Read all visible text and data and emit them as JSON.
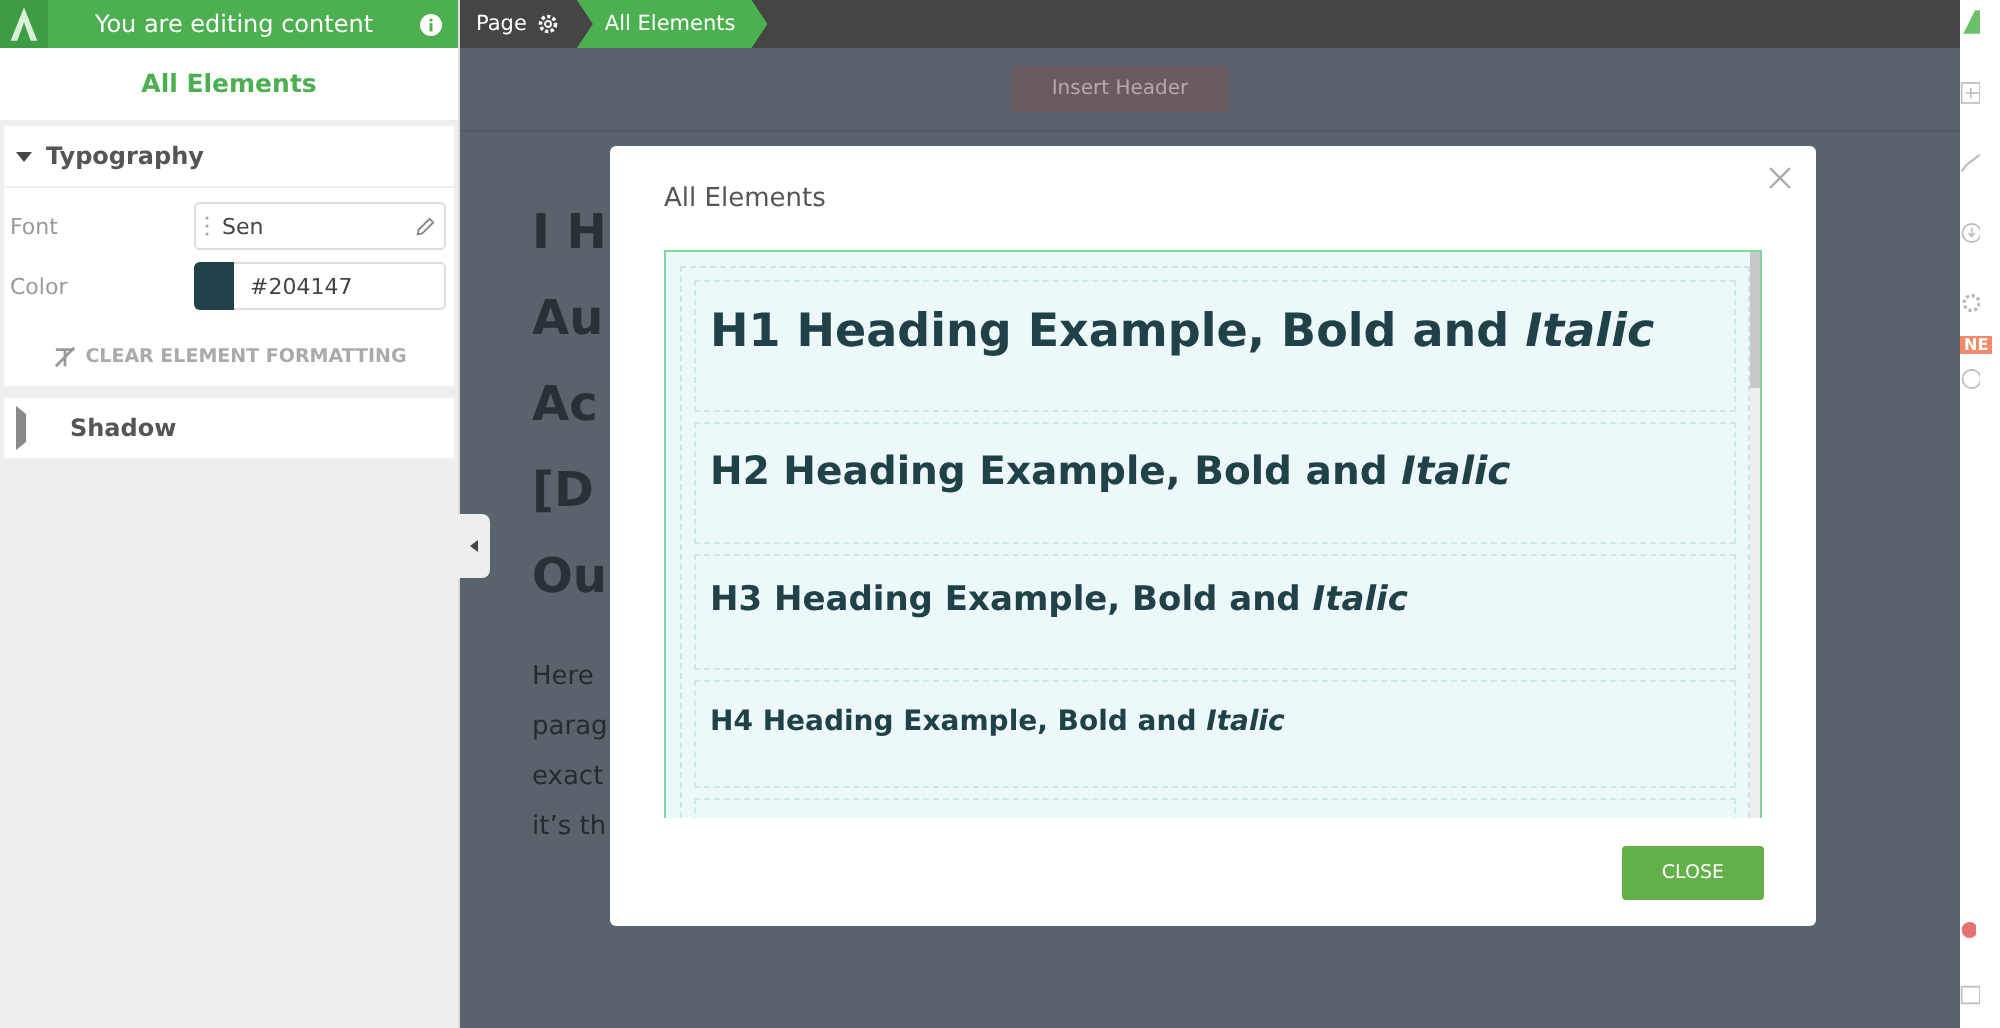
{
  "editor_bar": {
    "title": "You are editing content"
  },
  "panel": {
    "title": "All Elements",
    "sections": [
      {
        "title": "Typography",
        "expanded": true
      },
      {
        "title": "Shadow",
        "expanded": false
      }
    ],
    "font": {
      "label": "Font",
      "value": "Sen"
    },
    "color": {
      "label": "Color",
      "value": "#204147"
    },
    "clear_button": "CLEAR ELEMENT FORMATTING"
  },
  "breadcrumbs": [
    {
      "label": "Page",
      "kind": "page",
      "selected": false
    },
    {
      "label": "All Elements",
      "kind": "element",
      "selected": true
    }
  ],
  "canvas": {
    "insert_button": "Insert Header",
    "heading_lines": [
      "I H",
      "Au",
      "Ac",
      "[D",
      "Ou"
    ],
    "paragraph_lines": [
      "Here",
      "parag",
      "exact",
      "it’s th"
    ]
  },
  "right_toolbar": {
    "badge": "NE"
  },
  "modal": {
    "title": "All Elements",
    "headings": [
      {
        "text": "H1 Heading Example, Bold and *Italic*",
        "kind": "h1"
      },
      {
        "text": "H2 Heading Example, Bold and *Italic*",
        "kind": "h2"
      },
      {
        "text": "H3 Heading Example, Bold and *Italic*",
        "kind": "h3"
      },
      {
        "text": "H4 Heading Example, Bold and *Italic*",
        "kind": "h4"
      }
    ],
    "close_button": "CLOSE"
  }
}
